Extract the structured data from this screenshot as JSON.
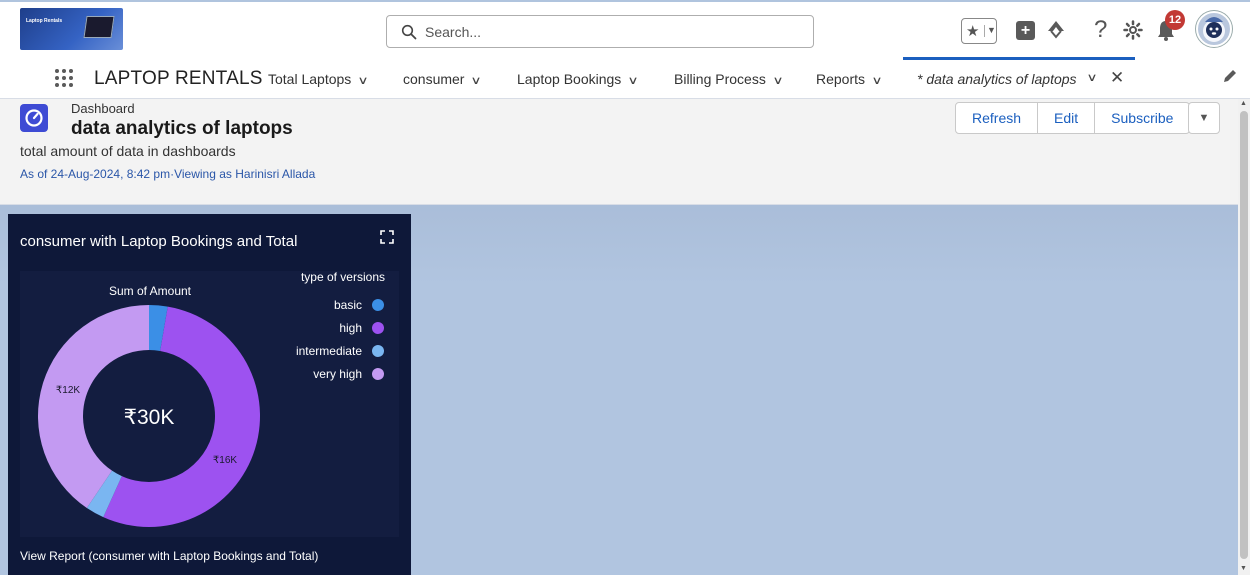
{
  "header": {
    "logo_text": "Laptop Rentals",
    "search_placeholder": "Search...",
    "notification_count": "12"
  },
  "nav": {
    "app_name": "LAPTOP RENTALS",
    "items": [
      {
        "label": "Total Laptops"
      },
      {
        "label": "consumer"
      },
      {
        "label": "Laptop Bookings"
      },
      {
        "label": "Billing Process"
      },
      {
        "label": "Reports"
      }
    ],
    "active_tab": "* data analytics of laptops"
  },
  "dashboard": {
    "type_label": "Dashboard",
    "title": "data analytics of laptops",
    "description": "total amount of data in dashboards",
    "as_of": "As of 24-Aug-2024, 8:42 pm·Viewing as Harinisri Allada",
    "buttons": {
      "refresh": "Refresh",
      "edit": "Edit",
      "subscribe": "Subscribe"
    }
  },
  "widget": {
    "title": "consumer with Laptop Bookings and Total",
    "footer": "View Report (consumer with Laptop Bookings and Total)"
  },
  "chart_data": {
    "type": "pie",
    "variant": "donut",
    "title": "Sum of Amount",
    "center_label": "₹30K",
    "legend_title": "type of versions",
    "legend_position": "right",
    "categories": [
      "basic",
      "high",
      "intermediate",
      "very high"
    ],
    "values": [
      0.8,
      16,
      0.8,
      12
    ],
    "colors": [
      "#3b8fe6",
      "#9d52f0",
      "#7ab6f1",
      "#c39af2"
    ],
    "data_labels": {
      "high": "₹16K",
      "very high": "₹12K"
    }
  }
}
